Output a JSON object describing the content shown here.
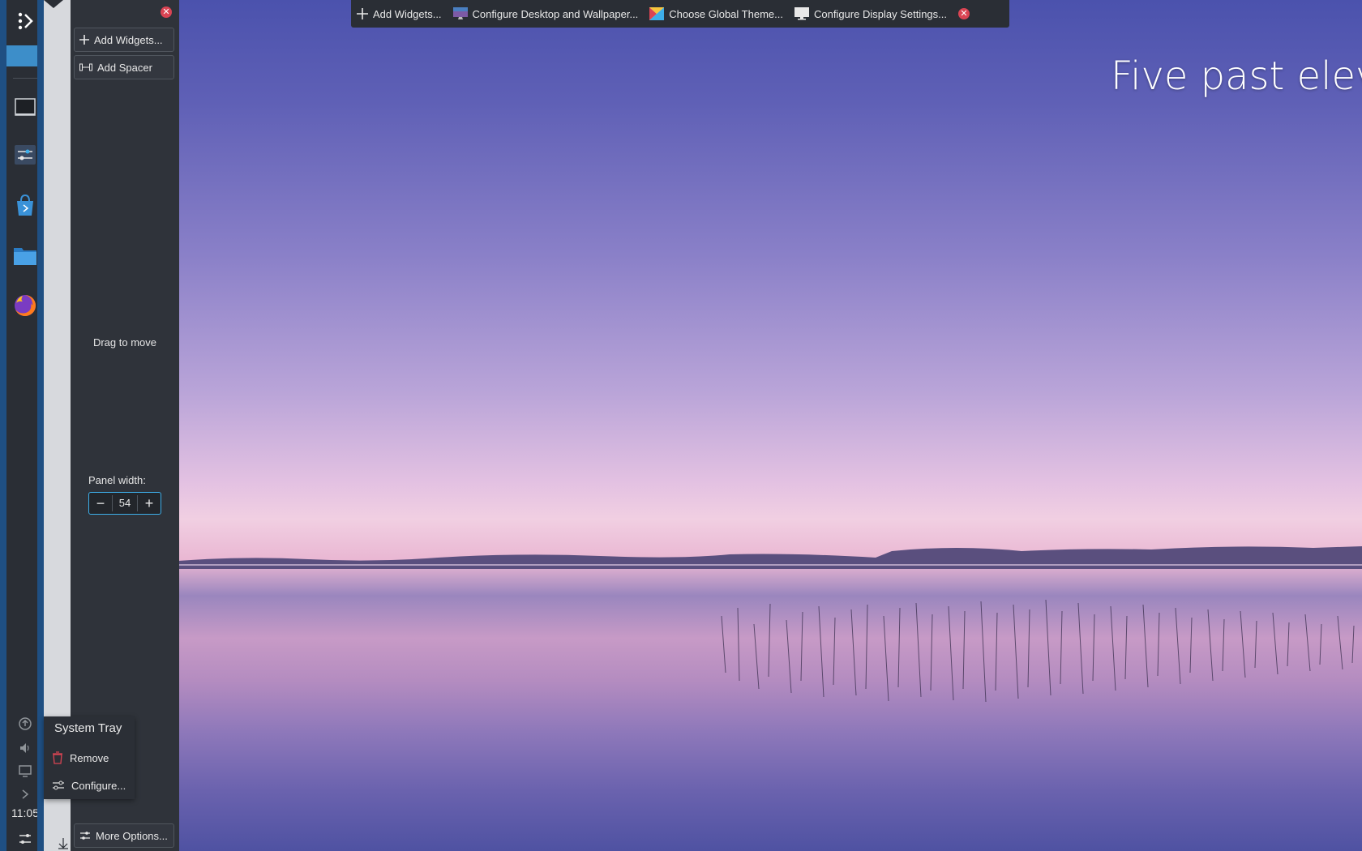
{
  "desktop": {
    "clock_text": "Five past eleve"
  },
  "toolbar": {
    "items": [
      {
        "label": "Add Widgets...",
        "icon": "plus-icon"
      },
      {
        "label": "Configure Desktop and Wallpaper...",
        "icon": "wallpaper-icon"
      },
      {
        "label": "Choose Global Theme...",
        "icon": "theme-icon"
      },
      {
        "label": "Configure Display Settings...",
        "icon": "display-icon"
      }
    ],
    "close_icon": "close-icon"
  },
  "panel": {
    "time": "11:05",
    "apps": [
      "launcher-icon",
      "desktop-icon",
      "settings-icon",
      "discover-icon",
      "files-icon",
      "firefox-icon"
    ],
    "tray_icons": [
      "update-icon",
      "volume-icon",
      "network-icon",
      "expand-icon",
      "panel-settings-icon"
    ]
  },
  "config": {
    "add_widgets": "Add Widgets...",
    "add_spacer": "Add Spacer",
    "drag_to_move": "Drag to move",
    "panel_width_label": "Panel width:",
    "panel_width_value": "54",
    "more_options": "More Options..."
  },
  "tray_popup": {
    "title": "System Tray",
    "remove": "Remove",
    "configure": "Configure..."
  },
  "colors": {
    "accent": "#3daee9",
    "panel": "#2a2e35",
    "close": "#da4453"
  }
}
